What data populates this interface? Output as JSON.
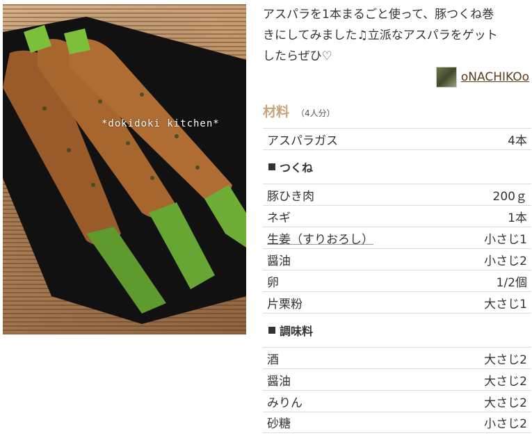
{
  "photo": {
    "watermark": "*dokidoki kitchen*"
  },
  "intro": "アスパラを1本まるごと使って、豚つくね巻\nきにしてみました♫立派なアスパラをゲット\nしたらぜひ♡",
  "author": {
    "name": "oNACHIKOo"
  },
  "ingredients": {
    "title": "材料",
    "servings": "（4人分）",
    "top": [
      {
        "name": "アスパラガス",
        "amount": "4本"
      }
    ],
    "groups": [
      {
        "label": "つくね",
        "items": [
          {
            "name": "豚ひき肉",
            "amount": "200ｇ"
          },
          {
            "name": "ネギ",
            "amount": "1本"
          },
          {
            "name": "生姜（すりおろし）",
            "amount": "小さじ1"
          },
          {
            "name": "醤油",
            "amount": "小さじ2"
          },
          {
            "name": "卵",
            "amount": "1/2個"
          },
          {
            "name": "片栗粉",
            "amount": "大さじ1"
          }
        ]
      },
      {
        "label": "調味料",
        "items": [
          {
            "name": "酒",
            "amount": "大さじ2"
          },
          {
            "name": "醤油",
            "amount": "大さじ2"
          },
          {
            "name": "みりん",
            "amount": "大さじ2"
          },
          {
            "name": "砂糖",
            "amount": "小さじ2"
          }
        ]
      }
    ]
  },
  "colors": {
    "accent": "#c9a47a",
    "author_link": "#5a3a1a",
    "divider": "#dddddd"
  }
}
